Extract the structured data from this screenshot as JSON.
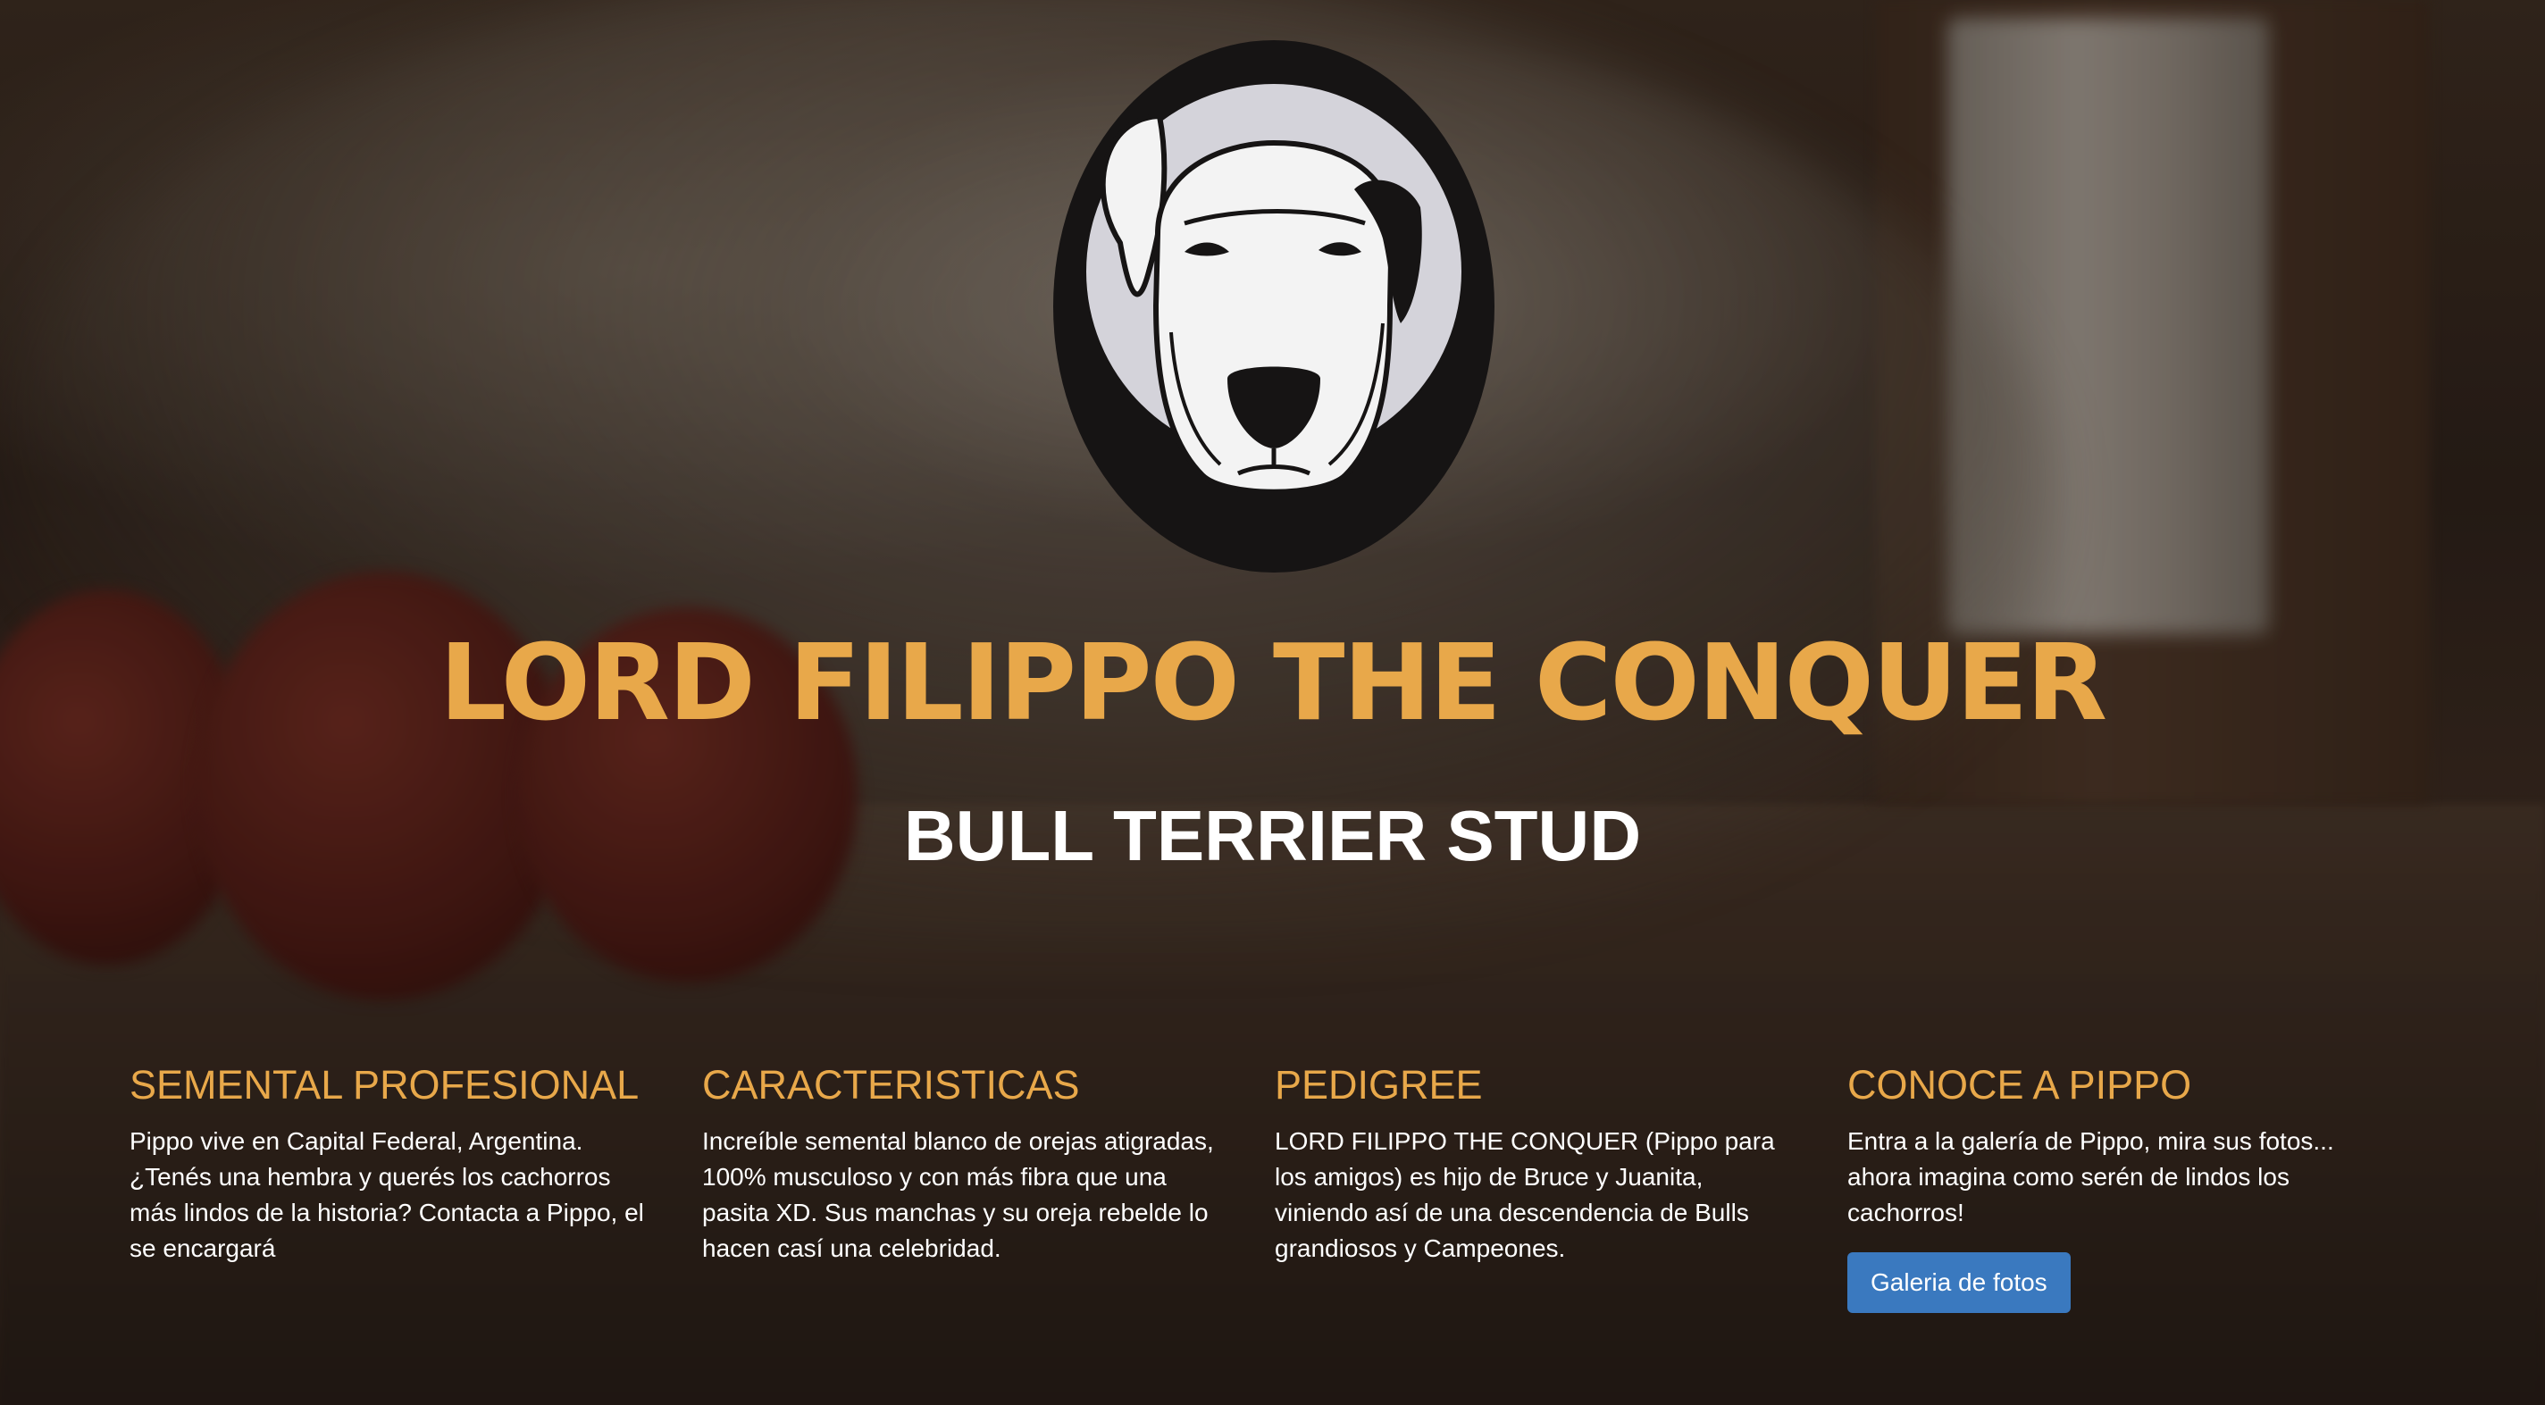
{
  "hero": {
    "title": "LORD FILIPPO THE CONQUER",
    "subtitle": "BULL TERRIER STUD"
  },
  "logo": {
    "icon": "bull-terrier-head-icon",
    "colors": {
      "badge": "#161414",
      "face": "#f3f3f3",
      "halo": "#d4d3da"
    }
  },
  "features": [
    {
      "heading": "SEMENTAL PROFESIONAL",
      "text": "Pippo vive en Capital Federal, Argentina. ¿Tenés una hembra y querés los cachorros más lindos de la historia? Contacta a Pippo, el se encargará"
    },
    {
      "heading": "CARACTERISTICAS",
      "text": "Increíble semental blanco de orejas atigradas, 100% musculoso y con más fibra que una pasita XD. Sus manchas y su oreja rebelde lo hacen casí una celebridad."
    },
    {
      "heading": "PEDIGREE",
      "text": "LORD FILIPPO THE CONQUER (Pippo para los amigos) es hijo de Bruce y Juanita, viniendo así de una descendencia de Bulls grandiosos y Campeones."
    },
    {
      "heading": "CONOCE A PIPPO",
      "text": "Entra a la galería de Pippo, mira sus fotos... ahora imagina como serén de lindos los cachorros!",
      "button_label": "Galeria de fotos"
    }
  ],
  "colors": {
    "accent": "#e8a84a",
    "button": "#3a79bf",
    "text": "#ffffff"
  }
}
